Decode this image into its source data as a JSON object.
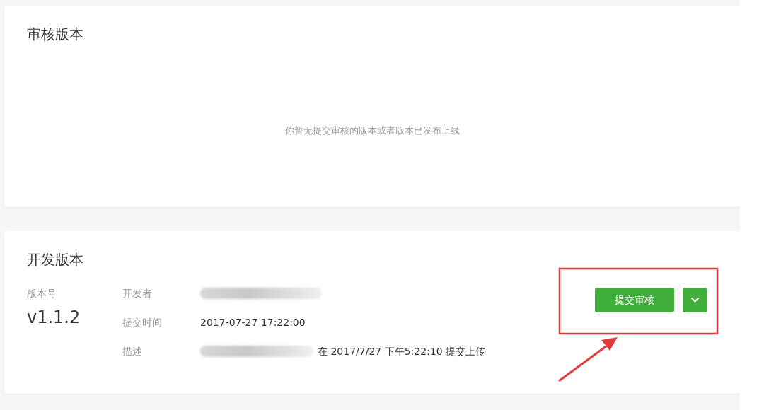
{
  "review_card": {
    "title": "审核版本",
    "empty_message": "你暂无提交审核的版本或者版本已发布上线"
  },
  "dev_card": {
    "title": "开发版本",
    "version_label": "版本号",
    "version": "v1.1.2",
    "fields": [
      {
        "label": "开发者",
        "redacted": true
      },
      {
        "label": "提交时间",
        "value": "2017-07-27 17:22:00",
        "redacted": false
      },
      {
        "label": "描述",
        "value": "在 2017/7/27 下午5:22:10 提交上传",
        "redacted": true
      }
    ],
    "submit_button": "提交审核"
  },
  "annotation": {
    "kind": "box-arrow",
    "color": "#e03c3c"
  }
}
